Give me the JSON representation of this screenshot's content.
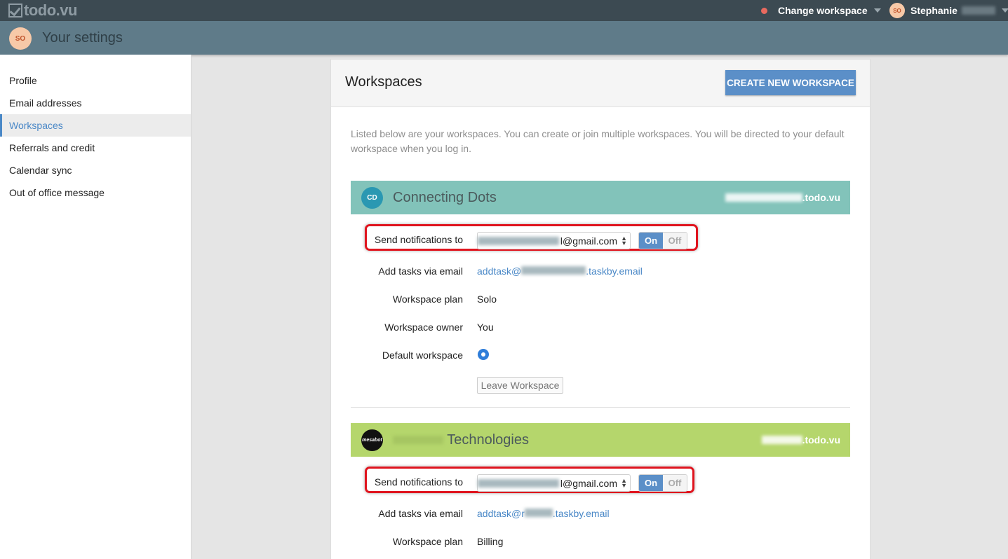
{
  "topbar": {
    "logo": "todo.vu",
    "change_workspace": "Change workspace",
    "user_initials": "SO",
    "user_name": "Stephanie"
  },
  "header": {
    "avatar_initials": "SO",
    "title": "Your settings"
  },
  "sidebar": {
    "items": [
      {
        "label": "Profile"
      },
      {
        "label": "Email addresses"
      },
      {
        "label": "Workspaces"
      },
      {
        "label": "Referrals and credit"
      },
      {
        "label": "Calendar sync"
      },
      {
        "label": "Out of office message"
      }
    ]
  },
  "main": {
    "title": "Workspaces",
    "create_button": "CREATE NEW WORKSPACE",
    "intro": "Listed below are your workspaces. You can create or join multiple workspaces. You will be directed to your default workspace when you log in.",
    "workspaces": [
      {
        "badge": "CD",
        "name": "Connecting Dots",
        "domain_suffix": ".todo.vu",
        "notify_label": "Send notifications to",
        "notify_email_suffix": "l@gmail.com",
        "toggle_on": "On",
        "toggle_off": "Off",
        "add_tasks_label": "Add tasks via email",
        "add_tasks_prefix": "addtask@",
        "add_tasks_suffix": ".taskby.email",
        "plan_label": "Workspace plan",
        "plan": "Solo",
        "owner_label": "Workspace owner",
        "owner": "You",
        "default_label": "Default workspace",
        "leave_button": "Leave Workspace"
      },
      {
        "badge": "mesabot",
        "name": "Technologies",
        "domain_suffix": ".todo.vu",
        "notify_label": "Send notifications to",
        "notify_email_suffix": "l@gmail.com",
        "toggle_on": "On",
        "toggle_off": "Off",
        "add_tasks_label": "Add tasks via email",
        "add_tasks_prefix": "addtask@r",
        "add_tasks_suffix": ".taskby.email",
        "plan_label": "Workspace plan",
        "plan": "Billing"
      }
    ]
  },
  "colors": {
    "topbar": "#3c4a52",
    "header": "#5f7b89",
    "accent": "#5b8fc8",
    "ws1_bar": "#82c3ba",
    "ws2_bar": "#b5d66c",
    "highlight": "#e0141e"
  }
}
